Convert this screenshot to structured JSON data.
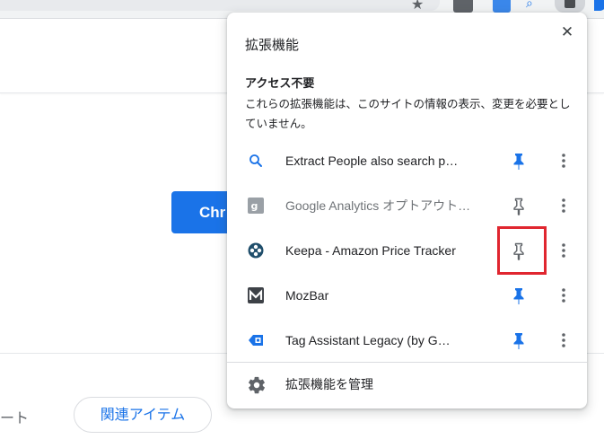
{
  "browser": {
    "icons": [
      "star-icon",
      "extension-icon",
      "extension-icon",
      "search-icon",
      "puzzle-icon",
      "avatar-icon"
    ]
  },
  "page": {
    "chrome_button_label": "Chr",
    "report_text": "ート",
    "related_items_label": "関連アイテム"
  },
  "extensions_panel": {
    "title": "拡張機能",
    "close_label": "✕",
    "section_heading": "アクセス不要",
    "section_description": "これらの拡張機能は、このサイトの情報の表示、変更を必要としていません。",
    "manage_label": "拡張機能を管理",
    "items": [
      {
        "name": "Extract People also search p…",
        "icon": "search-icon",
        "pinned": true
      },
      {
        "name": "Google Analytics オプトアウト…",
        "icon": "google-icon",
        "pinned": false
      },
      {
        "name": "Keepa - Amazon Price Tracker",
        "icon": "keepa-icon",
        "pinned": false
      },
      {
        "name": "MozBar",
        "icon": "moz-icon",
        "pinned": true
      },
      {
        "name": "Tag Assistant Legacy (by G…",
        "icon": "tag-icon",
        "pinned": true
      }
    ],
    "colors": {
      "pinned": "#1a73e8",
      "unpinned": "#5f6368",
      "highlight": "#e0262f"
    }
  }
}
